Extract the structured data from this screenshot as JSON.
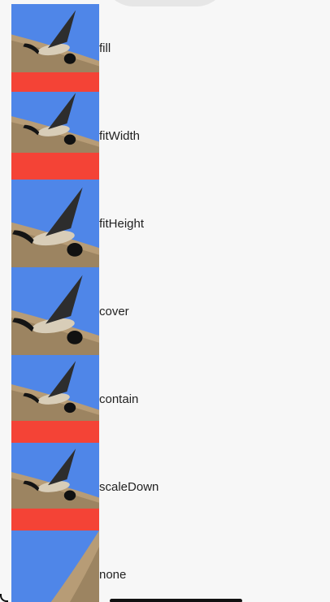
{
  "rows": [
    {
      "label": "fill",
      "image": "canada-goose-photo"
    },
    {
      "label": "fitWidth",
      "image": "canada-goose-photo"
    },
    {
      "label": "fitHeight",
      "image": "canada-goose-photo"
    },
    {
      "label": "cover",
      "image": "canada-goose-photo"
    },
    {
      "label": "contain",
      "image": "canada-goose-photo"
    },
    {
      "label": "scaleDown",
      "image": "canada-goose-photo"
    },
    {
      "label": "none",
      "image": "canada-goose-photo"
    }
  ],
  "colors": {
    "background": "#f7f7f7",
    "box": "#f44336",
    "sky": "#4f86e8",
    "ground": "#b79c76"
  }
}
